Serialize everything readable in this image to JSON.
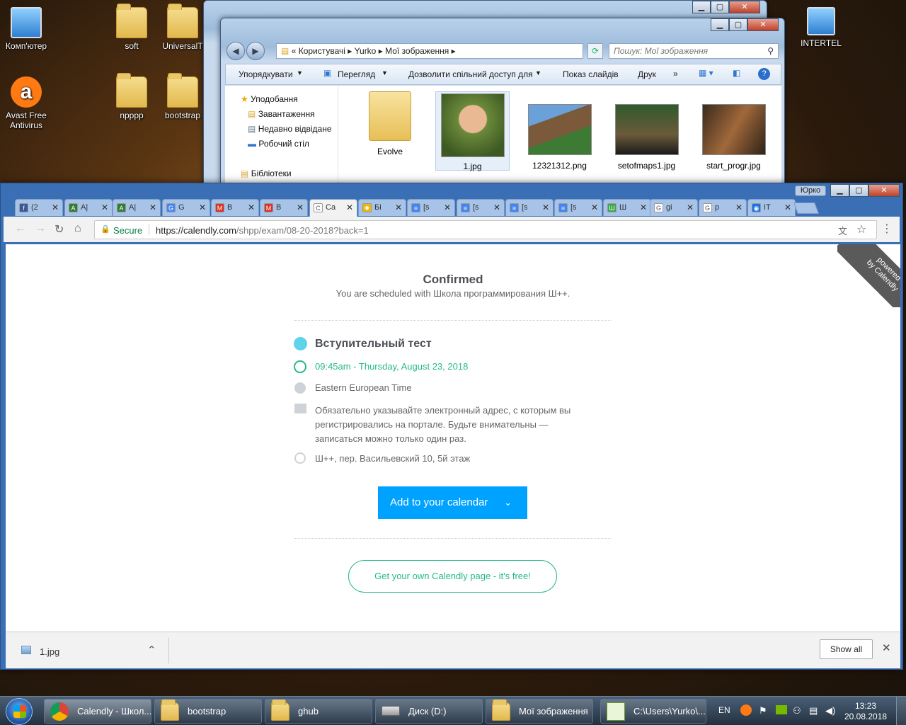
{
  "desktop": {
    "icons": [
      {
        "label": "Комп'ютер"
      },
      {
        "label": "soft"
      },
      {
        "label": "UniversalT"
      },
      {
        "label": "Avast Free Antivirus"
      },
      {
        "label": "npppp"
      },
      {
        "label": "bootstrap"
      },
      {
        "label": "INTERTEL"
      }
    ]
  },
  "explorer": {
    "breadcrumb": [
      "«",
      "Користувачі",
      "Yurko",
      "Мої зображення"
    ],
    "search_placeholder": "Пошук: Мої зображення",
    "menu": [
      "Упорядкувати",
      "Перегляд",
      "Дозволити спільний доступ для",
      "Показ слайдів",
      "Друк",
      "»"
    ],
    "nav": [
      "Уподобання",
      "Завантаження",
      "Недавно відвідане",
      "Робочий стіл",
      "Бібліотеки"
    ],
    "files": [
      "Evolve",
      "1.jpg",
      "12321312.png",
      "setofmaps1.jpg",
      "start_progr.jpg"
    ]
  },
  "chrome": {
    "user_badge": "Юрко",
    "tabs": [
      {
        "label": "(2",
        "color": "#3b5998",
        "glyph": "f"
      },
      {
        "label": "A|",
        "color": "#2e7d32",
        "glyph": "A"
      },
      {
        "label": "A|",
        "color": "#2e7d32",
        "glyph": "A"
      },
      {
        "label": "G",
        "color": "#4285f4",
        "glyph": "G"
      },
      {
        "label": "B",
        "color": "#d93025",
        "glyph": "M"
      },
      {
        "label": "B",
        "color": "#d93025",
        "glyph": "M"
      },
      {
        "label": "Ca",
        "color": "#ffffff",
        "glyph": "C"
      },
      {
        "label": "Бі",
        "color": "#f4b400",
        "glyph": "✹"
      },
      {
        "label": "[s",
        "color": "#4285f4",
        "glyph": "≡"
      },
      {
        "label": "[s",
        "color": "#4285f4",
        "glyph": "≡"
      },
      {
        "label": "[s",
        "color": "#4285f4",
        "glyph": "≡"
      },
      {
        "label": "[s",
        "color": "#4285f4",
        "glyph": "≡"
      },
      {
        "label": "Ш",
        "color": "#3aa547",
        "glyph": "Ш"
      },
      {
        "label": "gi",
        "color": "#ffffff",
        "glyph": "G"
      },
      {
        "label": "p",
        "color": "#ffffff",
        "glyph": "G"
      },
      {
        "label": "IT",
        "color": "#1a73e8",
        "glyph": "◉"
      }
    ],
    "secure_label": "Secure",
    "url_prefix": "https://calendly.com",
    "url_path": "/shpp/exam/08-20-2018?back=1"
  },
  "calendly": {
    "ribbon_line1": "powered",
    "ribbon_line2": "by Calendly",
    "title": "Confirmed",
    "subtitle": "You are scheduled with Школа программирования Ш++.",
    "event_name": "Вступительный тест",
    "event_color": "#5fd3e8",
    "datetime": "09:45am - Thursday, August 23, 2018",
    "timezone": "Eastern European Time",
    "note_line1": "Обязательно указывайте электронный адрес, с которым вы",
    "note_line2": "регистрировались на портале. Будьте внимательны —",
    "note_line3": "записаться можно только один раз.",
    "location": "Ш++, пер. Васильевский 10, 5й этаж",
    "add_calendar": "Add to your calendar",
    "own_page": "Get your own Calendly page - it's free!",
    "accent_color": "#00a2ff",
    "green_color": "#26b88e"
  },
  "downloads": {
    "file": "1.jpg",
    "show_all": "Show all"
  },
  "taskbar": {
    "items": [
      "Calendly - Школ...",
      "bootstrap",
      "ghub",
      "Диск (D:)",
      "Мої зображення",
      "C:\\Users\\Yurko\\..."
    ],
    "lang": "EN",
    "time": "13:23",
    "date": "20.08.2018"
  }
}
